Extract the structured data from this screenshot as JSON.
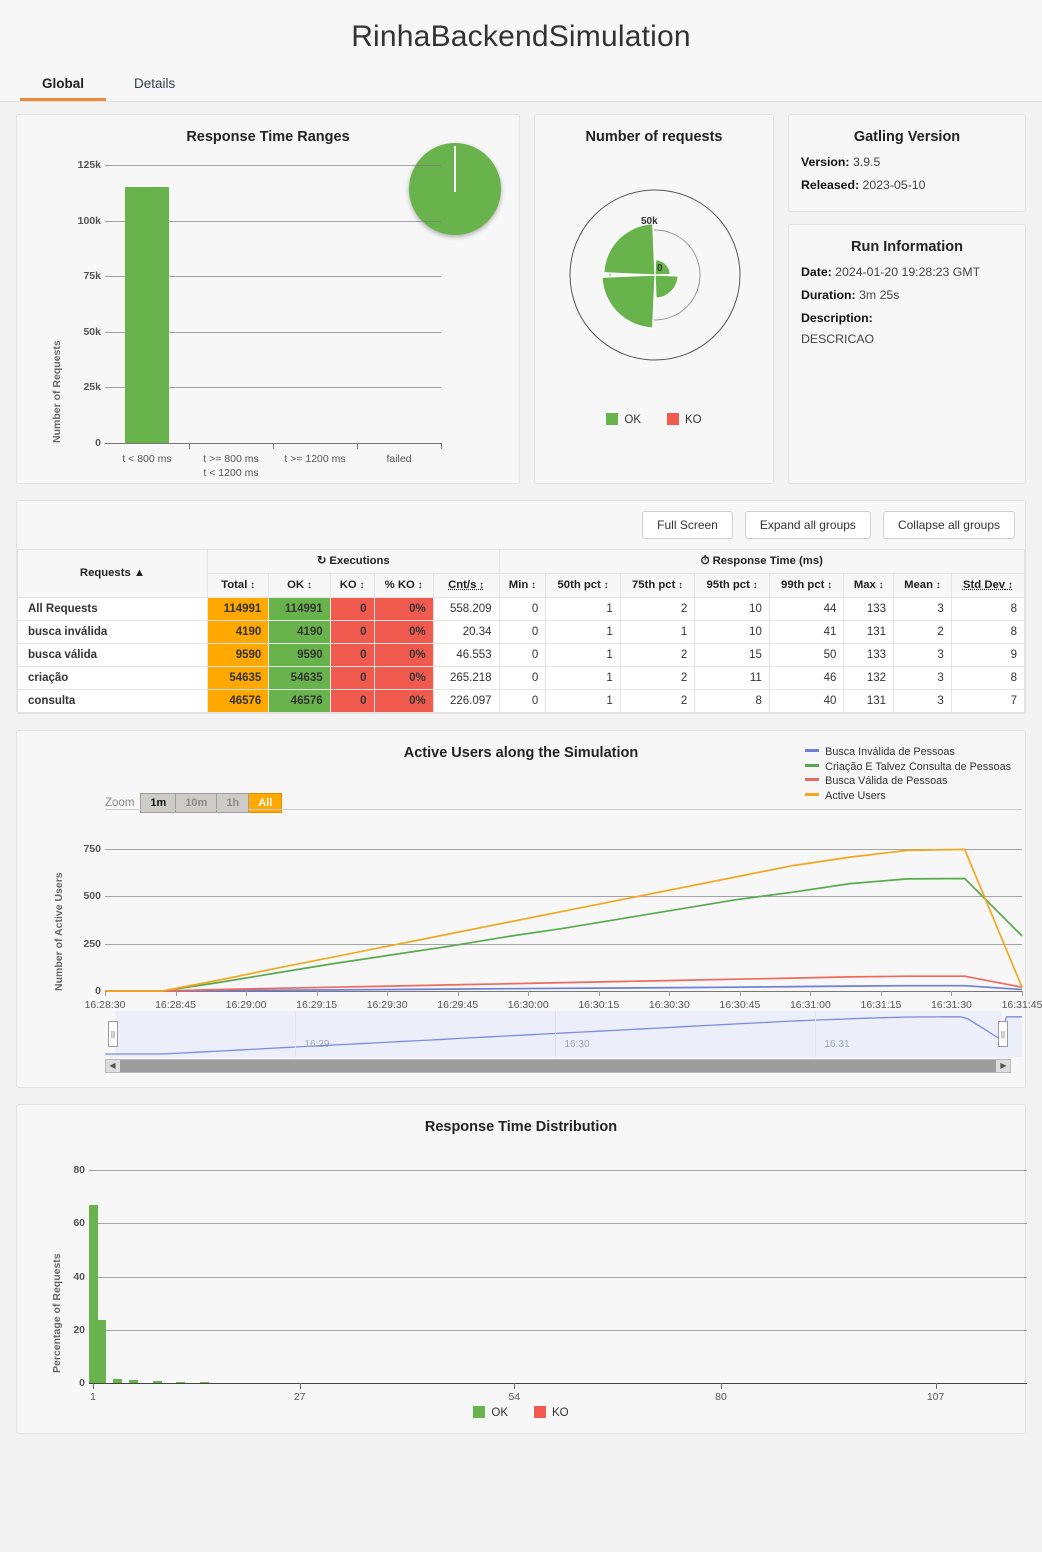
{
  "header": {
    "title": "RinhaBackendSimulation"
  },
  "tabs": [
    {
      "label": "Global",
      "active": true
    },
    {
      "label": "Details",
      "active": false
    }
  ],
  "colors": {
    "ok_green": "#68b34b",
    "ko_red": "#f15b4f",
    "total_orange": "#ffa800",
    "accent": "#eb8a3c",
    "series_blue": "#6d7fd6",
    "series_green": "#5aa84f",
    "series_red": "#ef6a5e",
    "series_orange": "#f0a81e"
  },
  "panels": {
    "response_time_ranges": {
      "title": "Response Time Ranges"
    },
    "number_of_requests": {
      "title": "Number of requests"
    },
    "gatling_version": {
      "title": "Gatling Version",
      "version_label": "Version:",
      "version_value": "3.9.5",
      "released_label": "Released:",
      "released_value": "2023-05-10"
    },
    "run_information": {
      "title": "Run Information",
      "date_label": "Date:",
      "date_value": "2024-01-20 19:28:23 GMT",
      "duration_label": "Duration:",
      "duration_value": "3m 25s",
      "description_label": "Description:",
      "description_value": "DESCRICAO"
    }
  },
  "toolbar": {
    "full_screen": "Full Screen",
    "expand_all": "Expand all groups",
    "collapse_all": "Collapse all groups"
  },
  "table": {
    "group_headers": {
      "requests": "Requests",
      "executions": "Executions",
      "response_time": "Response Time (ms)"
    },
    "columns": [
      "Total",
      "OK",
      "KO",
      "% KO",
      "Cnt/s",
      "Min",
      "50th pct",
      "75th pct",
      "95th pct",
      "99th pct",
      "Max",
      "Mean",
      "Std Dev"
    ],
    "rows": [
      {
        "name": "All Requests",
        "total": "114991",
        "ok": "114991",
        "ko": "0",
        "pct_ko": "0%",
        "cnt_s": "558.209",
        "min": "0",
        "p50": "1",
        "p75": "2",
        "p95": "10",
        "p99": "44",
        "max": "133",
        "mean": "3",
        "std_dev": "8"
      },
      {
        "name": "busca inválida",
        "total": "4190",
        "ok": "4190",
        "ko": "0",
        "pct_ko": "0%",
        "cnt_s": "20.34",
        "min": "0",
        "p50": "1",
        "p75": "1",
        "p95": "10",
        "p99": "41",
        "max": "131",
        "mean": "2",
        "std_dev": "8"
      },
      {
        "name": "busca válida",
        "total": "9590",
        "ok": "9590",
        "ko": "0",
        "pct_ko": "0%",
        "cnt_s": "46.553",
        "min": "0",
        "p50": "1",
        "p75": "2",
        "p95": "15",
        "p99": "50",
        "max": "133",
        "mean": "3",
        "std_dev": "9"
      },
      {
        "name": "criação",
        "total": "54635",
        "ok": "54635",
        "ko": "0",
        "pct_ko": "0%",
        "cnt_s": "265.218",
        "min": "0",
        "p50": "1",
        "p75": "2",
        "p95": "11",
        "p99": "46",
        "max": "132",
        "mean": "3",
        "std_dev": "8"
      },
      {
        "name": "consulta",
        "total": "46576",
        "ok": "46576",
        "ko": "0",
        "pct_ko": "0%",
        "cnt_s": "226.097",
        "min": "0",
        "p50": "1",
        "p75": "2",
        "p95": "8",
        "p99": "40",
        "max": "131",
        "mean": "3",
        "std_dev": "7"
      }
    ]
  },
  "active_users": {
    "title": "Active Users along the Simulation",
    "zoom_label": "Zoom",
    "zoom_buttons": [
      {
        "label": "1m",
        "active": false
      },
      {
        "label": "10m",
        "active": false
      },
      {
        "label": "1h",
        "active": false
      },
      {
        "label": "All",
        "active": true
      }
    ],
    "navigator_labels": [
      "16:29",
      "16:30",
      "16:31"
    ]
  },
  "response_time_distribution": {
    "title": "Response Time Distribution"
  },
  "legend_ok_ko": [
    {
      "label": "OK",
      "color": "#68b34b"
    },
    {
      "label": "KO",
      "color": "#f15b4f"
    }
  ],
  "chart_data": [
    {
      "id": "response-time-ranges",
      "type": "bar",
      "title": "Response Time Ranges",
      "xlabel": "",
      "ylabel": "Number of Requests",
      "categories": [
        "t < 800 ms",
        "t >= 800 ms\nt < 1200 ms",
        "t >= 1200 ms",
        "failed"
      ],
      "category_lines": [
        [
          "t < 800 ms"
        ],
        [
          "t >= 800 ms",
          "t < 1200 ms"
        ],
        [
          "t >= 1200 ms"
        ],
        [
          "failed"
        ]
      ],
      "values": [
        114991,
        0,
        0,
        0
      ],
      "colors": [
        "#68b34b",
        "#f7a35c",
        "#e74c3c",
        "#e74c3c"
      ],
      "ylim": [
        0,
        125000
      ],
      "yticks": [
        0,
        25000,
        50000,
        75000,
        100000,
        125000
      ],
      "ytick_labels": [
        "0",
        "25k",
        "50k",
        "75k",
        "100k",
        "125k"
      ],
      "grid": true,
      "gauge_percent": 100
    },
    {
      "id": "number-of-requests",
      "type": "pie",
      "subtype": "polar",
      "title": "Number of requests",
      "legend": [
        "OK",
        "KO"
      ],
      "legend_position": "bottom",
      "radial_ticks": [
        0,
        50000
      ],
      "radial_tick_labels": [
        "0",
        "50k"
      ],
      "rmax": 100000,
      "slices": [
        {
          "label": "busca inválida",
          "value": 4190,
          "color": "#68b34b"
        },
        {
          "label": "busca válida",
          "value": 9590,
          "color": "#68b34b"
        },
        {
          "label": "criação",
          "value": 54635,
          "color": "#68b34b"
        },
        {
          "label": "consulta",
          "value": 46576,
          "color": "#68b34b"
        }
      ]
    },
    {
      "id": "active-users",
      "type": "line",
      "title": "Active Users along the Simulation",
      "xlabel": "",
      "ylabel": "Number of Active Users",
      "ylim": [
        0,
        800
      ],
      "yticks": [
        0,
        250,
        500,
        750
      ],
      "ytick_labels": [
        "0",
        "250",
        "500",
        "750"
      ],
      "grid": true,
      "legend_position": "top-right",
      "xtick_labels": [
        "16:28:30",
        "16:28:45",
        "16:29:00",
        "16:29:15",
        "16:29:30",
        "16:29:45",
        "16:30:00",
        "16:30:15",
        "16:30:30",
        "16:30:45",
        "16:31:00",
        "16:31:15",
        "16:31:30",
        "16:31:45"
      ],
      "series": [
        {
          "name": "Busca Inválida de Pessoas",
          "color": "#6d7fd6",
          "values": [
            0,
            0,
            2,
            4,
            6,
            8,
            10,
            12,
            14,
            16,
            18,
            20,
            23,
            26,
            28,
            28,
            8
          ]
        },
        {
          "name": "Criação E Talvez Consulta de Pessoas",
          "color": "#5aa84f",
          "values": [
            0,
            0,
            45,
            95,
            145,
            190,
            235,
            285,
            330,
            380,
            430,
            480,
            520,
            565,
            590,
            592,
            290
          ]
        },
        {
          "name": "Busca Válida de Pessoas",
          "color": "#ef6a5e",
          "values": [
            0,
            0,
            8,
            14,
            20,
            26,
            32,
            38,
            44,
            50,
            56,
            62,
            68,
            74,
            78,
            78,
            20
          ]
        },
        {
          "name": "Active Users",
          "color": "#f0a81e",
          "values": [
            0,
            0,
            58,
            120,
            180,
            240,
            300,
            360,
            420,
            480,
            540,
            600,
            660,
            705,
            740,
            745,
            20
          ]
        }
      ]
    },
    {
      "id": "response-time-distribution",
      "type": "bar",
      "title": "Response Time Distribution",
      "xlabel": "",
      "ylabel": "Percentage of Requests",
      "ylim": [
        0,
        85
      ],
      "yticks": [
        0,
        20,
        40,
        60,
        80
      ],
      "ytick_labels": [
        "0",
        "20",
        "40",
        "60",
        "80"
      ],
      "xtick_labels": [
        "1",
        "27",
        "54",
        "80",
        "107"
      ],
      "xtick_positions": [
        1,
        27,
        54,
        80,
        107
      ],
      "grid": true,
      "legend": [
        "OK",
        "KO"
      ],
      "legend_position": "bottom",
      "bars": [
        {
          "x": 1,
          "value": 67.0
        },
        {
          "x": 2,
          "value": 23.8
        },
        {
          "x": 4,
          "value": 1.5
        },
        {
          "x": 6,
          "value": 1.0
        },
        {
          "x": 9,
          "value": 0.6
        },
        {
          "x": 12,
          "value": 0.5
        },
        {
          "x": 15,
          "value": 0.2
        }
      ],
      "bar_color": "#68b34b"
    }
  ]
}
